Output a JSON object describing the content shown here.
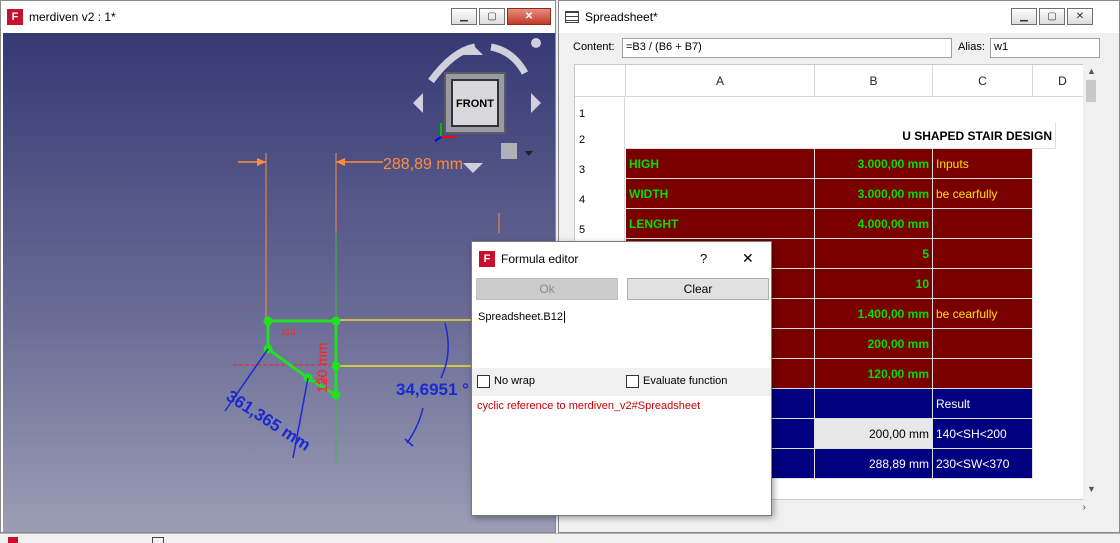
{
  "view_window": {
    "title": "merdiven v2 : 1*",
    "nav_cube_face": "FRONT",
    "dims": {
      "dim1": "288,89 mm",
      "dim2": "34,6951 °",
      "dim3": "361,365 mm",
      "dim4": "120 mm"
    }
  },
  "spreadsheet": {
    "title": "Spreadsheet*",
    "content_label": "Content:",
    "content_value": "=B3 / (B6 + B7)",
    "alias_label": "Alias:",
    "alias_value": "w1",
    "columns": [
      "A",
      "B",
      "C",
      "D"
    ],
    "rows": [
      "1",
      "2",
      "3",
      "4",
      "5"
    ],
    "cells": {
      "r2_title": "U SHAPED STAIR DESIGN",
      "r3": [
        "HIGH",
        "3.000,00 mm",
        "Inputs"
      ],
      "r4": [
        "WIDTH",
        "3.000,00 mm",
        "be cearfully"
      ],
      "r5": [
        "LENGHT",
        "4.000,00 mm",
        ""
      ],
      "r6": [
        "",
        "5",
        ""
      ],
      "r7": [
        "",
        "10",
        ""
      ],
      "r8": [
        "",
        "1.400,00 mm",
        "be cearfully"
      ],
      "r9": [
        "",
        "200,00 mm",
        ""
      ],
      "r10": [
        "",
        "120,00 mm",
        ""
      ],
      "r11": [
        "",
        "",
        "Result"
      ],
      "r12": [
        "",
        "200,00 mm",
        "140<SH<200"
      ],
      "r13": [
        "",
        "288,89 mm",
        "230<SW<370"
      ]
    }
  },
  "formula_editor": {
    "title": "Formula editor",
    "help": "?",
    "close": "✕",
    "ok_label": "Ok",
    "clear_label": "Clear",
    "expression": "Spreadsheet.B12",
    "no_wrap_label": "No wrap",
    "evaluate_label": "Evaluate function",
    "error": "cyclic reference to merdiven_v2#Spreadsheet"
  },
  "colors": {
    "cell_red": "#7a0000",
    "cell_blue": "#000080",
    "text_green": "#00e000",
    "text_yellow": "#ffe000",
    "error_red": "#cc0000",
    "dim_orange": "#ff8c3c",
    "dim_blue": "#2a3fd6"
  },
  "icons": [
    "freecad-logo",
    "minimize-icon",
    "maximize-icon",
    "close-icon",
    "spreadsheet-icon",
    "nav-arrow-icon"
  ]
}
